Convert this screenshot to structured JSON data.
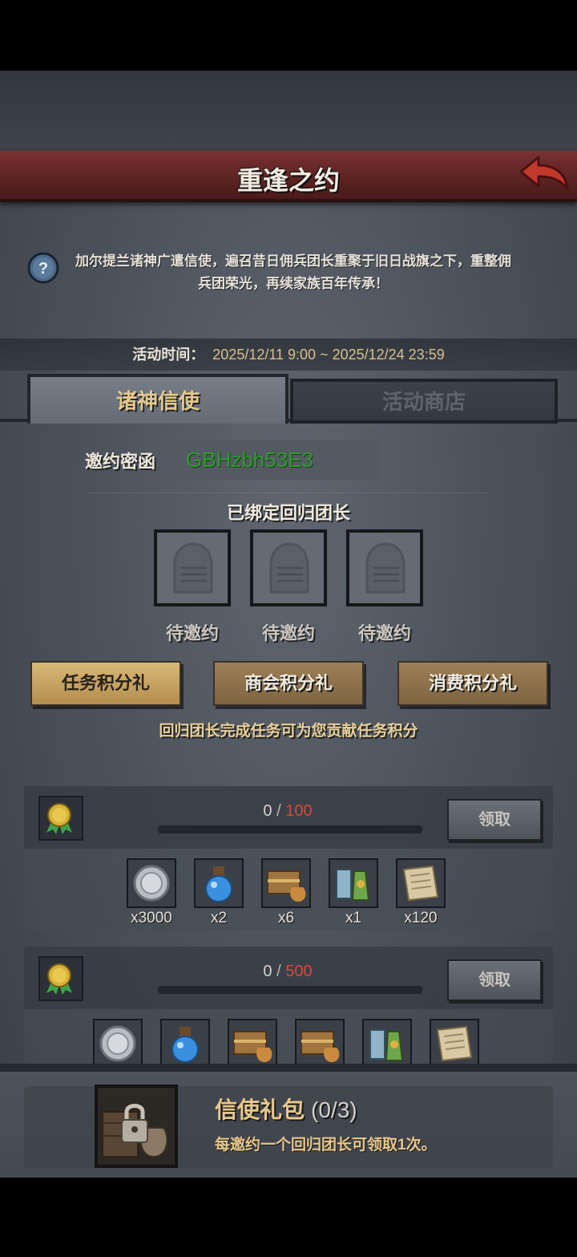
{
  "header": {
    "title": "重逢之约"
  },
  "description": {
    "text": "加尔提兰诸神广遣信使，遍召昔日佣兵团长重聚于旧日战旗之下，重整佣兵团荣光，再续家族百年传承！"
  },
  "activity_time": {
    "label": "活动时间：",
    "value": "2025/12/11 9:00 ~ 2025/12/24 23:59"
  },
  "tabs": [
    {
      "label": "诸神信使",
      "active": true
    },
    {
      "label": "活动商店",
      "active": false
    }
  ],
  "invite": {
    "label": "邀约密函",
    "code": "GBHzbh53E3"
  },
  "bound": {
    "title": "已绑定回归团长",
    "slots": [
      {
        "label": "待邀约"
      },
      {
        "label": "待邀约"
      },
      {
        "label": "待邀约"
      }
    ]
  },
  "gift_tabs": [
    {
      "label": "任务积分礼",
      "active": true
    },
    {
      "label": "商会积分礼",
      "active": false
    },
    {
      "label": "消费积分礼",
      "active": false
    }
  ],
  "hint": "回归团长完成任务可为您贡献任务积分",
  "rewards": [
    {
      "current": "0",
      "separator": "/",
      "target": "100",
      "claim_label": "领取",
      "items": [
        {
          "icon": "silver-coin-icon",
          "count": "x3000"
        },
        {
          "icon": "blue-potion-icon",
          "count": "x2"
        },
        {
          "icon": "treasure-chest-icon",
          "count": "x6"
        },
        {
          "icon": "elixir-bottles-icon",
          "count": "x1"
        },
        {
          "icon": "scroll-icon",
          "count": "x120"
        }
      ]
    },
    {
      "current": "0",
      "separator": "/",
      "target": "500",
      "claim_label": "领取",
      "items": [
        {
          "icon": "silver-coin-icon"
        },
        {
          "icon": "blue-potion-icon"
        },
        {
          "icon": "treasure-chest-icon"
        },
        {
          "icon": "treasure-chest-icon"
        },
        {
          "icon": "elixir-bottles-icon"
        },
        {
          "icon": "scroll-icon"
        }
      ]
    }
  ],
  "pack": {
    "title": "信使礼包",
    "count": "(0/3)",
    "description": "每邀约一个回归团长可领取1次。"
  },
  "colors": {
    "title_bar": "#6a2828",
    "gold_text": "#e4c98e",
    "invite_code": "#2f9a2f",
    "progress_target": "#d9483a"
  }
}
